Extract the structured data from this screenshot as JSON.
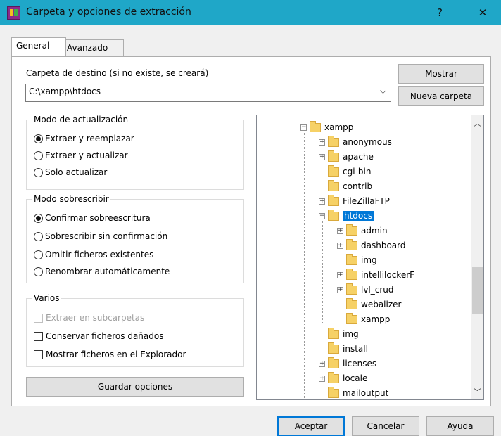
{
  "window": {
    "title": "Carpeta y opciones de extracción",
    "help": "?",
    "close": "✕"
  },
  "tabs": [
    "General",
    "Avanzado"
  ],
  "dest": {
    "label": "Carpeta de destino (si no existe, se creará)",
    "value": "C:\\xampp\\htdocs",
    "show_btn": "Mostrar",
    "new_btn": "Nueva carpeta"
  },
  "update_mode": {
    "title": "Modo de actualización",
    "options": [
      "Extraer y reemplazar",
      "Extraer y actualizar",
      "Solo actualizar"
    ],
    "selected": 0
  },
  "overwrite_mode": {
    "title": "Modo sobrescribir",
    "options": [
      "Confirmar sobreescritura",
      "Sobrescribir sin confirmación",
      "Omitir ficheros existentes",
      "Renombrar automáticamente"
    ],
    "selected": 0
  },
  "misc": {
    "title": "Varios",
    "items": [
      "Extraer en subcarpetas",
      "Conservar ficheros dañados",
      "Mostrar ficheros en el Explorador"
    ]
  },
  "save_btn": "Guardar opciones",
  "tree": {
    "nodes": [
      {
        "label": "xampp",
        "exp": "−"
      },
      {
        "label": "anonymous",
        "exp": "+"
      },
      {
        "label": "apache",
        "exp": "+"
      },
      {
        "label": "cgi-bin",
        "exp": ""
      },
      {
        "label": "contrib",
        "exp": ""
      },
      {
        "label": "FileZillaFTP",
        "exp": "+"
      },
      {
        "label": "htdocs",
        "exp": "−"
      },
      {
        "label": "admin",
        "exp": "+"
      },
      {
        "label": "dashboard",
        "exp": "+"
      },
      {
        "label": "img",
        "exp": ""
      },
      {
        "label": "intellilockerF",
        "exp": "+"
      },
      {
        "label": "lvl_crud",
        "exp": "+"
      },
      {
        "label": "webalizer",
        "exp": ""
      },
      {
        "label": "xampp",
        "exp": ""
      },
      {
        "label": "img",
        "exp": ""
      },
      {
        "label": "install",
        "exp": ""
      },
      {
        "label": "licenses",
        "exp": "+"
      },
      {
        "label": "locale",
        "exp": "+"
      },
      {
        "label": "mailoutput",
        "exp": ""
      }
    ],
    "selected": "htdocs"
  },
  "footer": {
    "ok": "Aceptar",
    "cancel": "Cancelar",
    "help": "Ayuda"
  }
}
